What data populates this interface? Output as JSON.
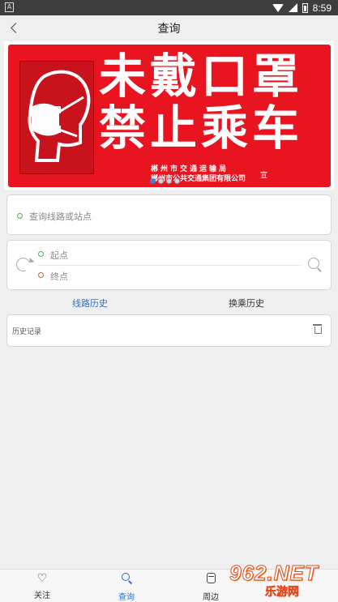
{
  "status_bar": {
    "time": "8:59",
    "left_badge": "A"
  },
  "header": {
    "title": "查询"
  },
  "banner": {
    "line1": "未戴口罩",
    "line2": "禁止乘车",
    "credit1": "郴州市交通运输局",
    "credit2": "郴州市公共交通集团有限公司",
    "credit_extra": "宣",
    "slide_count": 4,
    "active_slide": 0
  },
  "search": {
    "placeholder": "查询线路或站点"
  },
  "route": {
    "start_placeholder": "起点",
    "end_placeholder": "终点"
  },
  "tabs": {
    "route_history": "线路历史",
    "transfer_history": "换乘历史",
    "active": "route_history"
  },
  "history": {
    "label": "历史记录"
  },
  "bottom_nav": {
    "follow": "关注",
    "query": "查询",
    "nearby": "周边",
    "active": "query"
  },
  "watermark": {
    "brand": "962.NET",
    "site": "乐游网"
  },
  "colors": {
    "accent": "#2a6fc9",
    "banner_red": "#e8141f",
    "start_dot": "#4caf50",
    "end_dot": "#c75c5c"
  }
}
